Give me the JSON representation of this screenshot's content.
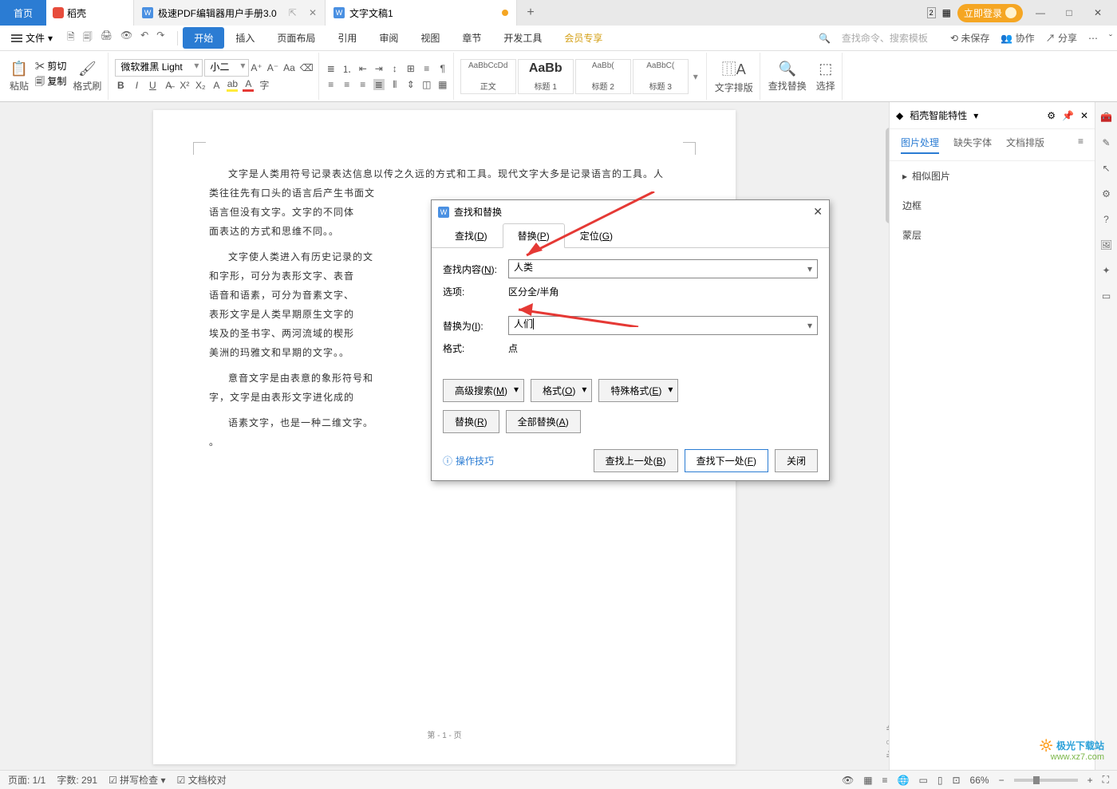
{
  "titlebar": {
    "home": "首页",
    "docer": "稻壳",
    "tabs": [
      {
        "label": "极速PDF编辑器用户手册3.0"
      },
      {
        "label": "文字文稿1",
        "active": true,
        "modified": true
      }
    ],
    "login": "立即登录"
  },
  "menubar": {
    "file": "文件",
    "tabs": [
      "开始",
      "插入",
      "页面布局",
      "引用",
      "审阅",
      "视图",
      "章节",
      "开发工具",
      "会员专享"
    ],
    "active": 0,
    "search_placeholder": "查找命令、搜索模板",
    "unsaved": "未保存",
    "coop": "协作",
    "share": "分享"
  },
  "ribbon": {
    "paste": "粘贴",
    "cut": "剪切",
    "copy": "复制",
    "brush": "格式刷",
    "font_name": "微软雅黑 Light",
    "font_size": "小二",
    "styles": [
      {
        "preview": "AaBbCcDd",
        "name": "正文"
      },
      {
        "preview": "AaBb",
        "name": "标题 1",
        "big": true
      },
      {
        "preview": "AaBb(",
        "name": "标题 2"
      },
      {
        "preview": "AaBbC(",
        "name": "标题 3"
      }
    ],
    "text_layout": "文字排版",
    "find_replace": "查找替换",
    "select": "选择"
  },
  "doc": {
    "paragraphs": [
      "文字是人类用符号记录表达信息以传之久远的方式和工具。现代文字大多是记录语言的工具。人类往往先有口头的语言后产生书面文",
      "语言但没有文字。文字的不同体",
      "面表达的方式和思维不同。。",
      "文字使人类进入有历史记录的文",
      "和字形，可分为表形文字、表音",
      "语音和语素，可分为音素文字、",
      "表形文字是人类早期原生文字的",
      "埃及的圣书字、两河流域的楔形",
      "美洲的玛雅文和早期的文字。。",
      "意音文字是由表意的象形符号和",
      "字，文字是由表形文字进化成的",
      "语素文字，也是一种二维文字。",
      "。"
    ],
    "page_footer": "第 - 1 - 页"
  },
  "rightpane": {
    "title": "稻壳智能特性",
    "tabs": [
      "图片处理",
      "缺失字体",
      "文档排版"
    ],
    "items": [
      "相似图片",
      "边框",
      "蒙层"
    ]
  },
  "dialog": {
    "title": "查找和替换",
    "tabs": [
      {
        "l": "查找(",
        "k": "D",
        "r": ")"
      },
      {
        "l": "替换(",
        "k": "P",
        "r": ")"
      },
      {
        "l": "定位(",
        "k": "G",
        "r": ")"
      }
    ],
    "active_tab": 1,
    "find_label": "查找内容(",
    "find_key": "N",
    "find_r": "):",
    "find_value": "人类",
    "options_label": "选项:",
    "options_value": "区分全/半角",
    "replace_label": "替换为(",
    "replace_key": "I",
    "replace_r": "):",
    "replace_value": "人们",
    "format_label": "格式:",
    "format_value": "点",
    "adv_search": "高级搜索(",
    "adv_key": "M",
    "adv_r": ")",
    "format_btn": "格式(",
    "format_key": "O",
    "format_br": ")",
    "special_btn": "特殊格式(",
    "special_key": "E",
    "special_br": ")",
    "replace_btn": "替换(",
    "replace_bkey": "R",
    "replace_br": ")",
    "replace_all": "全部替换(",
    "replace_all_key": "A",
    "replace_all_r": ")",
    "tips": "操作技巧",
    "find_prev": "查找上一处(",
    "find_prev_key": "B",
    "find_prev_r": ")",
    "find_next": "查找下一处(",
    "find_next_key": "F",
    "find_next_r": ")",
    "close": "关闭"
  },
  "status": {
    "page": "页面: 1/1",
    "words": "字数: 291",
    "spell": "拼写检查",
    "proof": "文档校对",
    "zoom": "66%"
  },
  "watermark": {
    "logo": "极光下载站",
    "url": "www.xz7.com"
  }
}
